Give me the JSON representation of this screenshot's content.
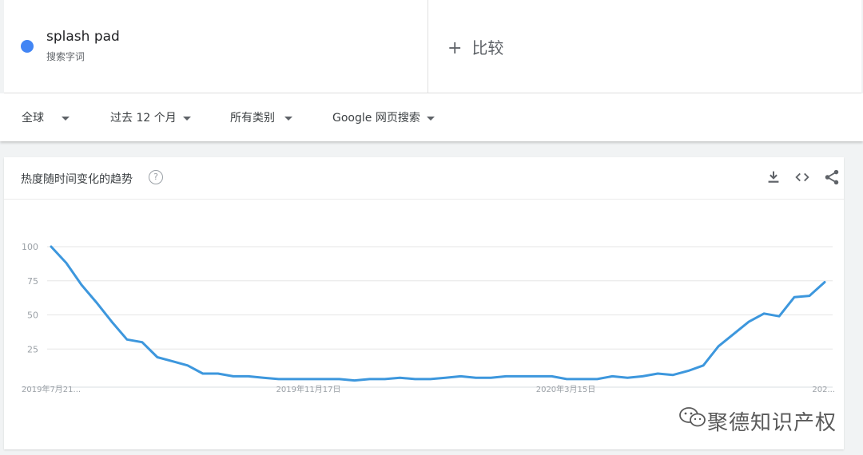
{
  "term": {
    "name": "splash pad",
    "subtitle": "搜索字词",
    "color": "#4285f4"
  },
  "compare": {
    "plus": "+",
    "label": "比较"
  },
  "filters": {
    "region": "全球",
    "time": "过去 12 个月",
    "category": "所有类别",
    "search_type": "Google 网页搜索"
  },
  "card": {
    "title": "热度随时间变化的趋势",
    "help": "?",
    "icons": [
      "download-icon",
      "embed-code-icon",
      "share-icon"
    ]
  },
  "watermark": "聚德知识产权",
  "chart_data": {
    "type": "line",
    "y_ticks": [
      "100",
      "75",
      "50",
      "25"
    ],
    "ylim": [
      0,
      100
    ],
    "x_tick_labels": [
      "2019年7月21...",
      "2019年11月17日",
      "2020年3月15日",
      "202..."
    ],
    "grid": true,
    "color": "#3d97dd",
    "series": [
      {
        "values": [
          100,
          88,
          72,
          59,
          45,
          32,
          30,
          19,
          16,
          13,
          7,
          7,
          5,
          5,
          4,
          3,
          3,
          3,
          3,
          3,
          2,
          3,
          3,
          4,
          3,
          3,
          4,
          5,
          4,
          4,
          5,
          5,
          5,
          5,
          3,
          3,
          3,
          5,
          4,
          5,
          7,
          6,
          9,
          13,
          27,
          36,
          45,
          51,
          49,
          63,
          64,
          74
        ]
      }
    ]
  }
}
